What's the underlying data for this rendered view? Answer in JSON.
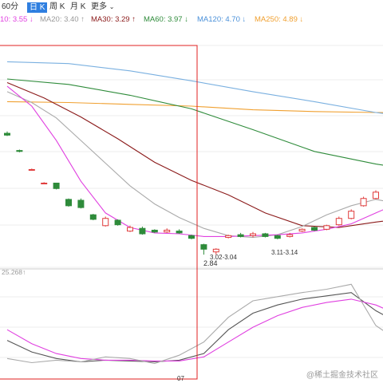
{
  "toolbar": {
    "period_label": "60分",
    "tabs": [
      {
        "label": "日 K",
        "active": true
      },
      {
        "label": "周 K",
        "active": false
      },
      {
        "label": "月 K",
        "active": false
      }
    ],
    "more_label": "更多"
  },
  "ma_row": [
    {
      "text": "10: 3.55 ↓",
      "color": "#e040e0"
    },
    {
      "text": "MA20: 3.40 ↑",
      "color": "#999999"
    },
    {
      "text": "MA30: 3.29 ↑",
      "color": "#8b1a1a"
    },
    {
      "text": "MA60: 3.97 ↓",
      "color": "#2e8b3a"
    },
    {
      "text": "MA120: 4.70 ↓",
      "color": "#4a90d9"
    },
    {
      "text": "MA250: 4.89 ↓",
      "color": "#f0a030"
    }
  ],
  "annotations": {
    "low_label": "2.84",
    "range_label_1": "3.02-3.04",
    "range_label_2": "3.11-3.14",
    "indicator_label": "25.268↑",
    "date_label": "07"
  },
  "watermark": "@稀土掘金技术社区",
  "colors": {
    "up": "#e03c3c",
    "down": "#2e8b3a",
    "highlight_box": "#e02020",
    "ma10": "#e040e0",
    "ma20": "#aaaaaa",
    "ma30": "#8b1a1a",
    "ma60": "#2e8b3a",
    "ma120": "#7ab0e0",
    "ma250": "#f0a030",
    "kdj_k": "#555555",
    "kdj_d": "#e040e0",
    "kdj_j": "#aaaaaa"
  },
  "chart_data": {
    "type": "candlestick",
    "candles": [
      {
        "o": 4.18,
        "c": 4.16,
        "h": 4.2,
        "l": 4.15
      },
      {
        "o": 3.99,
        "c": 3.98,
        "h": 4.0,
        "l": 3.97
      },
      {
        "o": 3.78,
        "c": 3.78,
        "h": 3.79,
        "l": 3.77
      },
      {
        "o": 3.63,
        "c": 3.63,
        "h": 3.64,
        "l": 3.62
      },
      {
        "o": 3.63,
        "c": 3.57,
        "h": 3.63,
        "l": 3.56
      },
      {
        "o": 3.45,
        "c": 3.38,
        "h": 3.46,
        "l": 3.37
      },
      {
        "o": 3.44,
        "c": 3.36,
        "h": 3.46,
        "l": 3.35
      },
      {
        "o": 3.28,
        "c": 3.23,
        "h": 3.29,
        "l": 3.22
      },
      {
        "o": 3.16,
        "c": 3.24,
        "h": 3.26,
        "l": 3.15
      },
      {
        "o": 3.22,
        "c": 3.17,
        "h": 3.23,
        "l": 3.16
      },
      {
        "o": 3.1,
        "c": 3.14,
        "h": 3.16,
        "l": 3.09
      },
      {
        "o": 3.13,
        "c": 3.07,
        "h": 3.15,
        "l": 3.06
      },
      {
        "o": 3.11,
        "c": 3.09,
        "h": 3.12,
        "l": 3.08
      },
      {
        "o": 3.09,
        "c": 3.11,
        "h": 3.13,
        "l": 3.08
      },
      {
        "o": 3.1,
        "c": 3.08,
        "h": 3.12,
        "l": 3.07
      },
      {
        "o": 3.05,
        "c": 3.02,
        "h": 3.06,
        "l": 3.01
      },
      {
        "o": 2.95,
        "c": 2.9,
        "h": 2.96,
        "l": 2.84
      },
      {
        "o": 2.87,
        "c": 2.9,
        "h": 2.91,
        "l": 2.84
      },
      {
        "o": 3.03,
        "c": 3.05,
        "h": 3.06,
        "l": 3.02
      },
      {
        "o": 3.06,
        "c": 3.04,
        "h": 3.08,
        "l": 3.03
      },
      {
        "o": 3.05,
        "c": 3.07,
        "h": 3.09,
        "l": 3.03
      },
      {
        "o": 3.07,
        "c": 3.04,
        "h": 3.08,
        "l": 3.03
      },
      {
        "o": 3.05,
        "c": 3.02,
        "h": 3.06,
        "l": 3.01
      },
      {
        "o": 3.04,
        "c": 3.06,
        "h": 3.08,
        "l": 3.03
      },
      {
        "o": 3.1,
        "c": 3.12,
        "h": 3.13,
        "l": 3.09
      },
      {
        "o": 3.14,
        "c": 3.11,
        "h": 3.15,
        "l": 3.1
      },
      {
        "o": 3.12,
        "c": 3.16,
        "h": 3.17,
        "l": 3.11
      },
      {
        "o": 3.17,
        "c": 3.24,
        "h": 3.26,
        "l": 3.16
      },
      {
        "o": 3.24,
        "c": 3.32,
        "h": 3.34,
        "l": 3.23
      },
      {
        "o": 3.38,
        "c": 3.46,
        "h": 3.48,
        "l": 3.37
      },
      {
        "o": 3.46,
        "c": 3.53,
        "h": 3.55,
        "l": 3.45
      },
      {
        "o": 3.58,
        "c": 3.68,
        "h": 3.74,
        "l": 3.57
      },
      {
        "o": 3.56,
        "c": 3.44,
        "h": 3.58,
        "l": 3.42
      },
      {
        "o": 3.46,
        "c": 3.5,
        "h": 3.53,
        "l": 3.45
      }
    ],
    "ma_series": [
      {
        "key": "ma250",
        "name": "MA250",
        "x": [
          0,
          5,
          10,
          15,
          20,
          25,
          30,
          35
        ],
        "y": [
          4.53,
          4.52,
          4.5,
          4.48,
          4.44,
          4.42,
          4.41,
          4.41
        ]
      },
      {
        "key": "ma120",
        "name": "MA120",
        "x": [
          0,
          5,
          10,
          15,
          20,
          25,
          30,
          35
        ],
        "y": [
          4.97,
          4.95,
          4.87,
          4.76,
          4.64,
          4.53,
          4.41,
          4.32
        ]
      },
      {
        "key": "ma60",
        "name": "MA60",
        "x": [
          0,
          5,
          10,
          15,
          20,
          25,
          30,
          35
        ],
        "y": [
          4.78,
          4.72,
          4.6,
          4.45,
          4.22,
          3.98,
          3.84,
          3.74
        ]
      },
      {
        "key": "ma30",
        "name": "MA30",
        "x": [
          0,
          3,
          6,
          9,
          12,
          15,
          18,
          21,
          24,
          27,
          30,
          35
        ],
        "y": [
          4.74,
          4.57,
          4.36,
          4.12,
          3.86,
          3.66,
          3.5,
          3.3,
          3.16,
          3.14,
          3.2,
          3.28
        ]
      },
      {
        "key": "ma20",
        "name": "MA20",
        "x": [
          0,
          2,
          4,
          6,
          8,
          10,
          12,
          14,
          16,
          18,
          20,
          22,
          24,
          26,
          28,
          30,
          32,
          35
        ],
        "y": [
          4.64,
          4.52,
          4.35,
          4.1,
          3.85,
          3.6,
          3.4,
          3.25,
          3.13,
          3.05,
          3.03,
          3.06,
          3.15,
          3.28,
          3.38,
          3.45,
          3.4,
          3.36
        ]
      },
      {
        "key": "ma10",
        "name": "MA10",
        "x": [
          0,
          2,
          4,
          6,
          8,
          10,
          12,
          14,
          16,
          18,
          20,
          22,
          24,
          26,
          28,
          30,
          32,
          35
        ],
        "y": [
          4.7,
          4.48,
          4.1,
          3.65,
          3.3,
          3.14,
          3.08,
          3.07,
          3.04,
          3.04,
          3.05,
          3.06,
          3.08,
          3.12,
          3.18,
          3.3,
          3.42,
          3.48
        ]
      }
    ],
    "kdj": {
      "x": [
        0,
        2,
        4,
        6,
        8,
        10,
        12,
        14,
        16,
        18,
        20,
        22,
        24,
        26,
        28,
        30,
        32,
        34
      ],
      "k": [
        42,
        28,
        20,
        16,
        18,
        17,
        16,
        18,
        26,
        55,
        75,
        85,
        92,
        96,
        100,
        78,
        62,
        40
      ],
      "d": [
        55,
        38,
        26,
        20,
        18,
        18,
        17,
        17,
        22,
        40,
        58,
        72,
        82,
        88,
        92,
        85,
        72,
        58
      ],
      "j": [
        20,
        15,
        18,
        16,
        22,
        20,
        14,
        24,
        40,
        70,
        90,
        95,
        100,
        104,
        110,
        60,
        40,
        15
      ]
    },
    "y_range": [
      2.7,
      5.15
    ],
    "kdj_range": [
      0,
      120
    ]
  }
}
